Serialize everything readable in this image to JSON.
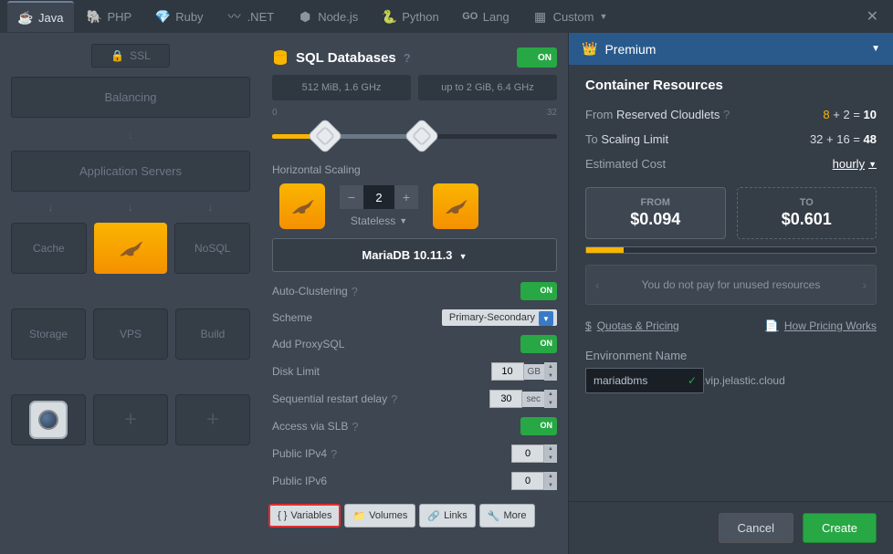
{
  "tabs": {
    "items": [
      {
        "label": "Java"
      },
      {
        "label": "PHP"
      },
      {
        "label": "Ruby"
      },
      {
        "label": ".NET"
      },
      {
        "label": "Node.js"
      },
      {
        "label": "Python"
      },
      {
        "label": "Lang"
      },
      {
        "label": "Custom"
      }
    ]
  },
  "left_panel": {
    "ssl": "SSL",
    "balancing": "Balancing",
    "app_servers": "Application Servers",
    "cache": "Cache",
    "nosql": "NoSQL",
    "storage": "Storage",
    "vps": "VPS",
    "build": "Build"
  },
  "mid_panel": {
    "title": "SQL Databases",
    "toggle": "ON",
    "spec1": "512 MiB, 1.6 GHz",
    "spec2": "up to 2 GiB, 6.4 GHz",
    "slider_min": "0",
    "slider_max": "32",
    "hscale_label": "Horizontal Scaling",
    "hscale_count": "2",
    "stateless": "Stateless",
    "db_version": "MariaDB 10.11.3",
    "auto_cluster": "Auto-Clustering",
    "scheme": "Scheme",
    "scheme_val": "Primary-Secondary",
    "proxysql": "Add ProxySQL",
    "disk_limit": "Disk Limit",
    "disk_val": "10",
    "disk_unit": "GB",
    "restart_delay": "Sequential restart delay",
    "restart_val": "30",
    "restart_unit": "sec",
    "slb": "Access via SLB",
    "ipv4": "Public IPv4",
    "ipv4_val": "0",
    "ipv6": "Public IPv6",
    "ipv6_val": "0",
    "btn_variables": "Variables",
    "btn_volumes": "Volumes",
    "btn_links": "Links",
    "btn_more": "More"
  },
  "right_panel": {
    "premium": "Premium",
    "title": "Container Resources",
    "from_label": "From",
    "from_link": "Reserved Cloudlets",
    "from_a": "8",
    "from_b": "2",
    "from_total": "10",
    "to_label": "To",
    "to_link": "Scaling Limit",
    "to_a": "32",
    "to_b": "16",
    "to_total": "48",
    "est_cost": "Estimated Cost",
    "hourly": "hourly",
    "cost_from_label": "FROM",
    "cost_from_val": "$0.094",
    "cost_to_label": "TO",
    "cost_to_val": "$0.601",
    "info": "You do not pay for unused resources",
    "quotas": "Quotas & Pricing",
    "how_pricing": "How Pricing Works",
    "env_label": "Environment Name",
    "env_val": "mariadbms",
    "domain": ".vip.jelastic.cloud"
  },
  "footer": {
    "cancel": "Cancel",
    "create": "Create"
  }
}
